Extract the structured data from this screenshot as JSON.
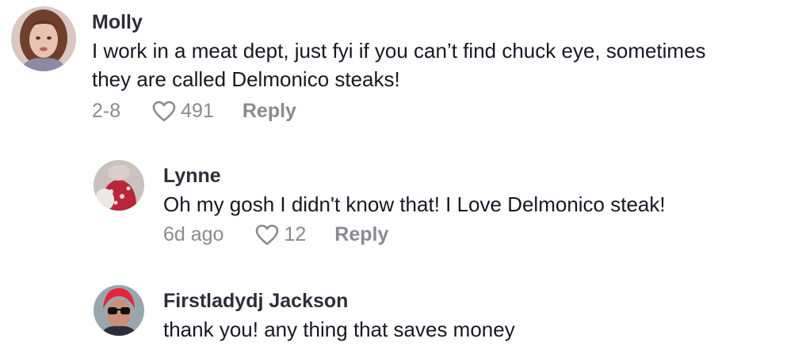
{
  "comments": [
    {
      "username": "Molly",
      "text_line1": "I work in a meat dept, just fyi if you can’t find chuck eye, sometimes",
      "text_line2": "they are called Delmonico steaks!",
      "date": "2-8",
      "likes": "491",
      "reply_label": "Reply",
      "avatar": "avatar-photo-woman-brown-hair"
    },
    {
      "username": "Lynne",
      "text": "Oh my gosh I didn't know that! I Love Delmonico steak!",
      "date": "6d ago",
      "likes": "12",
      "reply_label": "Reply",
      "avatar": "avatar-photo-dog"
    },
    {
      "username": "Firstladydj Jackson",
      "text": "thank you! any thing that saves money",
      "avatar": "avatar-photo-woman-red-hair-sunglasses"
    }
  ],
  "colors": {
    "text": "#161823",
    "meta": "#8a8b91",
    "background": "#ffffff"
  }
}
